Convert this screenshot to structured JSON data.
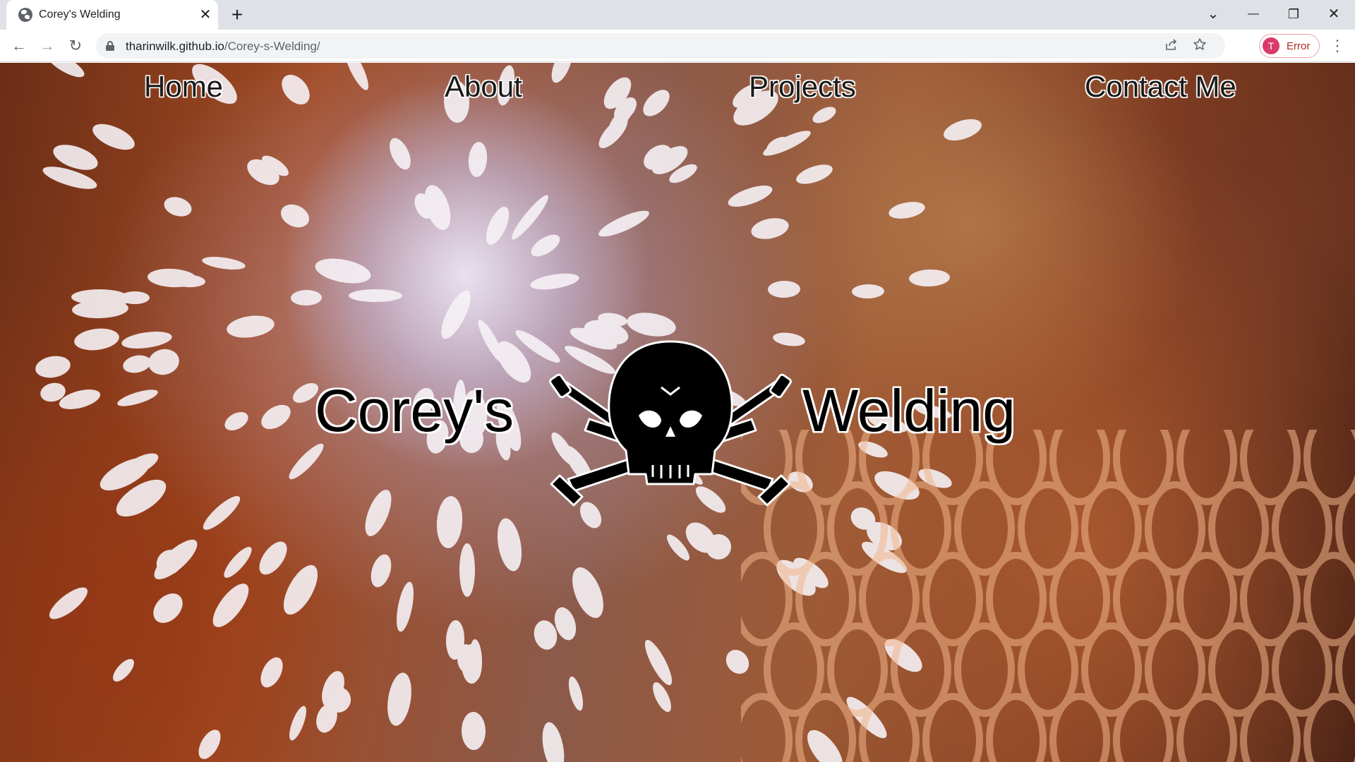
{
  "browser": {
    "tab_title": "Corey's Welding",
    "tab_close": "✕",
    "new_tab": "+",
    "window_controls": {
      "tab_search": "⌄",
      "minimize": "—",
      "restore": "❐",
      "close": "✕"
    },
    "nav": {
      "back": "←",
      "forward": "→",
      "reload": "↻"
    },
    "url_host": "tharinwilk.github.io",
    "url_path": "/Corey-s-Welding/",
    "share_icon": "share-icon",
    "bookmark_icon": "star-icon",
    "profile": {
      "initial": "T",
      "label": "Error",
      "avatar_color": "#d93a6b"
    },
    "menu": "⋮"
  },
  "site": {
    "nav": [
      "Home",
      "About",
      "Projects",
      "Contact Me"
    ],
    "hero": {
      "left_word": "Corey's",
      "right_word": "Welding"
    },
    "logo": "skull-with-welding-torches-logo",
    "background": "welding-sparks-photo"
  }
}
